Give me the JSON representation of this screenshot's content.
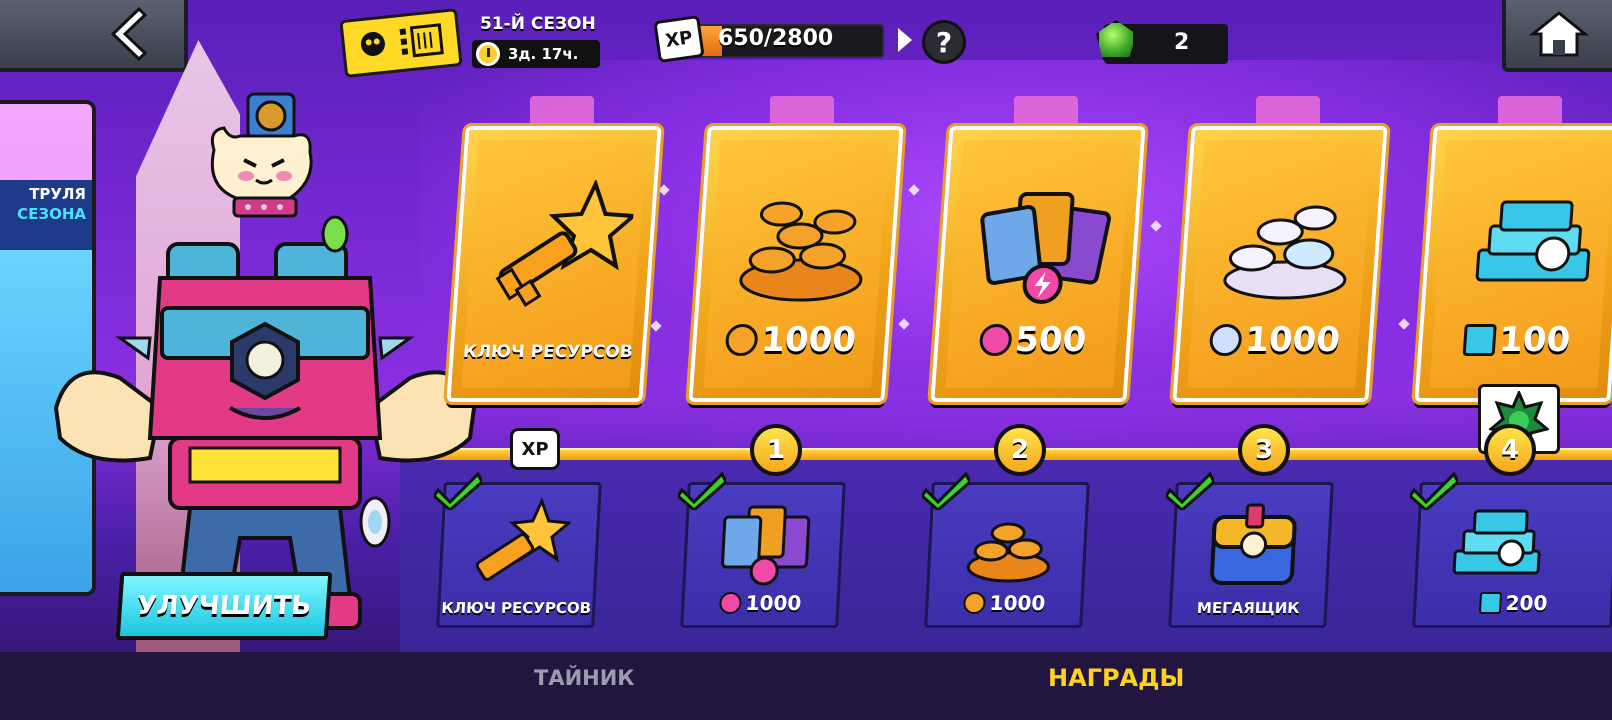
{
  "header": {
    "season_name": "51-Й СЕЗОН",
    "season_timer": "3д. 17ч.",
    "xp_label": "XP",
    "xp_progress": "650/2800",
    "xp_fraction": 0.232,
    "help_label": "?",
    "gems_count": "2"
  },
  "left_panel": {
    "line1": "ТРУЛЯ",
    "line2": "СЕЗОНА"
  },
  "upgrade_button": "УЛУЧШИТЬ",
  "premium_rewards": [
    {
      "label": "КЛЮЧ РЕСУРСОВ",
      "amount": "",
      "icon": "star-key-icon"
    },
    {
      "label": "",
      "amount": "1000",
      "icon": "coin-icon"
    },
    {
      "label": "",
      "amount": "500",
      "icon": "power-point-icon"
    },
    {
      "label": "",
      "amount": "1000",
      "icon": "credit-icon"
    },
    {
      "label": "",
      "amount": "100",
      "icon": "bling-icon"
    }
  ],
  "levels": {
    "xp_badge": "XP",
    "l1": "1",
    "l2": "2",
    "l3": "3",
    "l4": "4"
  },
  "free_rewards": [
    {
      "label": "КЛЮЧ РЕСУРСОВ",
      "amount": "",
      "claimed": true
    },
    {
      "label": "",
      "amount": "1000",
      "claimed": true,
      "icon": "power-point-icon"
    },
    {
      "label": "",
      "amount": "1000",
      "claimed": true,
      "icon": "coin-icon"
    },
    {
      "label": "МЕГАЯЩИК",
      "amount": "",
      "claimed": true
    },
    {
      "label": "",
      "amount": "200",
      "claimed": true,
      "icon": "bling-icon"
    }
  ],
  "bottom_nav": {
    "tab_stash": "ТАЙНИК",
    "tab_rewards": "НАГРАДЫ"
  },
  "colors": {
    "accent": "#ffd21e",
    "card": "#f3a41c",
    "check": "#3bd22a"
  }
}
